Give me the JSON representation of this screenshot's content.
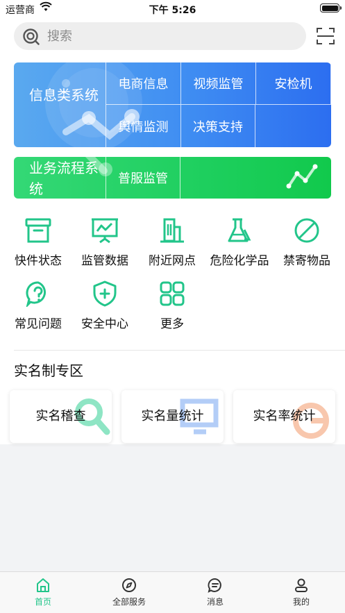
{
  "status_bar": {
    "carrier": "运营商",
    "time": "下午 5:26"
  },
  "search": {
    "placeholder": "搜索"
  },
  "banner_info": {
    "title": "信息类系统",
    "cells": [
      "电商信息",
      "视频监管",
      "安检机",
      "舆情监测",
      "决策支持"
    ]
  },
  "banner_business": {
    "title": "业务流程系统",
    "cells": [
      "普服监管"
    ]
  },
  "grid": [
    {
      "label": "快件状态",
      "icon": "archive-box-icon"
    },
    {
      "label": "监管数据",
      "icon": "presentation-chart-icon"
    },
    {
      "label": "附近网点",
      "icon": "building-icon"
    },
    {
      "label": "危险化学品",
      "icon": "flask-icon"
    },
    {
      "label": "禁寄物品",
      "icon": "prohibited-icon"
    },
    {
      "label": "常见问题",
      "icon": "question-icon"
    },
    {
      "label": "安全中心",
      "icon": "shield-plus-icon"
    },
    {
      "label": "更多",
      "icon": "grid-more-icon"
    }
  ],
  "real_name": {
    "title": "实名制专区",
    "cards": [
      {
        "label": "实名稽查",
        "icon": "magnifier-icon"
      },
      {
        "label": "实名量统计",
        "icon": "monitor-icon"
      },
      {
        "label": "实名率统计",
        "icon": "pie-chart-icon"
      }
    ]
  },
  "tabbar": [
    {
      "label": "首页",
      "icon": "home-icon",
      "active": true
    },
    {
      "label": "全部服务",
      "icon": "compass-icon",
      "active": false
    },
    {
      "label": "消息",
      "icon": "message-icon",
      "active": false
    },
    {
      "label": "我的",
      "icon": "user-icon",
      "active": false
    }
  ],
  "colors": {
    "accent": "#22c58a",
    "banner_blue": "#3f8df2",
    "banner_green": "#1ecf5e"
  }
}
